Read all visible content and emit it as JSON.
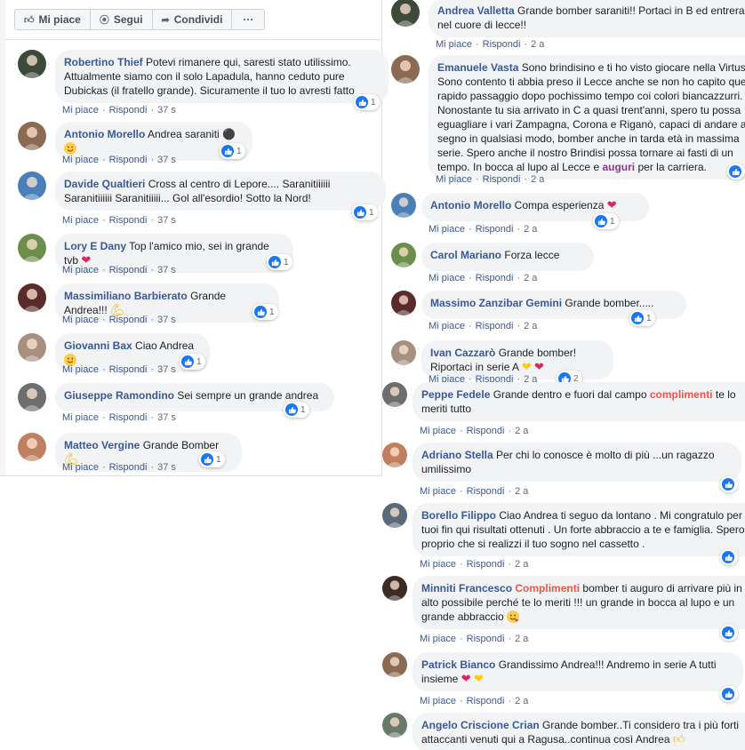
{
  "actions": {
    "like": "Mi piace",
    "follow": "Segui",
    "share": "Condividi",
    "more": "···"
  },
  "labels": {
    "like": "Mi piace",
    "reply": "Rispondi",
    "dot": "·"
  },
  "left": [
    {
      "author": "Robertino Thief",
      "pre": "Potevi rimanere qui, saresti stato utilissimo. Attualmente siamo con il solo Lapadula, hanno ceduto pure Dubickas (il fratello grande). Sicuramente il tuo lo avresti fatto",
      "time": "37 s",
      "count": "1"
    },
    {
      "author": "Antonio Morello",
      "pre": "Andrea saraniti",
      "time": "37 s",
      "count": "1"
    },
    {
      "author": "Davide Qualtieri",
      "pre": "Cross al centro di Lepore.... Saranitiiiiii Saranitiiiiii Saranitiiiii... Gol all'esordio! Sotto la Nord!",
      "time": "37 s",
      "count": "1"
    },
    {
      "author": "Lory E Dany",
      "pre": "Top l'amico mio, sei in grande tvb",
      "time": "37 s",
      "count": "1"
    },
    {
      "author": "Massimiliano Barbierato",
      "pre": "Grande Andrea!!!",
      "time": "37 s",
      "count": "1"
    },
    {
      "author": "Giovanni Bax",
      "pre": "Ciao Andrea",
      "time": "37 s",
      "count": "1"
    },
    {
      "author": "Giuseppe Ramondino",
      "pre": "Sei sempre un grande andrea",
      "time": "37 s",
      "count": "1"
    },
    {
      "author": "Matteo Vergine",
      "pre": "Grande Bomber",
      "time": "37 s",
      "count": "1"
    }
  ],
  "right": [
    {
      "author": "Andrea Valletta",
      "pre": "Grande bomber saraniti!! Portaci in B ed entrerai nel cuore di lecce!!",
      "time": "2 a",
      "count": ""
    },
    {
      "author": "Emanuele Vasta",
      "pre": "Sono brindisino e ti ho visto giocare nella Virtus. Sono contento ti abbia preso il Lecce anche se non ho capito ques rapido passaggio dopo pochissimo tempo coi colori biancazzurri. Nonostante tu sia arrivato in C a quasi trent'anni, spero tu possa eguagliare i vari Zampagna, Corona e Riganò, capaci di andare a segno in qualsiasi modo, bomber anche in tarda età in massima serie. Spero anche il nostro Brindisi possa tornare ai fasti di un tempo. In bocca al lupo al Lecce e",
      "hl": "auguri",
      "post": "per la carriera.",
      "time": "2 a",
      "count": ""
    },
    {
      "author": "Antonio Morello",
      "pre": "Compa esperienza",
      "time": "2 a",
      "count": "1"
    },
    {
      "author": "Carol Mariano",
      "pre": "Forza lecce",
      "time": "2 a",
      "count": ""
    },
    {
      "author": "Massimo Zanzibar Gemini",
      "pre": "Grande bomber.....",
      "time": "2 a",
      "count": "1"
    },
    {
      "author": "Ivan Cazzarò",
      "pre": "Grande bomber! Riportaci in serie A",
      "time": "2 a",
      "count": "2"
    },
    {
      "author": "Peppe Fedele",
      "pre": "Grande dentro e fuori dal campo",
      "hl": "complimenti",
      "post": "te lo meriti tutto",
      "time": "2 a",
      "count": ""
    },
    {
      "author": "Adriano Stella",
      "pre": "Per chi lo conosce è molto di più ...un ragazzo umilissimo",
      "time": "2 a",
      "count": ""
    },
    {
      "author": "Borello Filippo",
      "pre": "Ciao Andrea ti seguo da lontano . Mi congratulo per i tuoi fin qui risultati ottenuti . Un forte abbraccio a te e famiglia. Spero proprio che si realizzi il tuo sogno nel cassetto .",
      "time": "2 a",
      "count": ""
    },
    {
      "author": "Minniti Francesco",
      "hl": "Complimenti",
      "post": "bomber ti auguro di arrivare più in alto possibile perché te lo meriti !!! un grande in bocca al lupo e un grande abbraccio",
      "time": "2 a",
      "count": ""
    },
    {
      "author": "Patrick Bianco",
      "pre": "Grandissimo Andrea!!! Andremo in serie A tutti insieme",
      "time": "2 a",
      "count": ""
    },
    {
      "author": "Angelo Criscione Crian",
      "pre": "Grande bomber..Ti considero tra i più forti attaccanti venuti qui a Ragusa..continua così Andrea",
      "time": "",
      "count": ""
    }
  ],
  "colors": {
    "link": "#385898",
    "bubble": "#f2f3f5",
    "like": "#1877f2",
    "meta": "#606770",
    "accent_red": "#e9574b",
    "accent_purple": "#8b3a8b"
  }
}
